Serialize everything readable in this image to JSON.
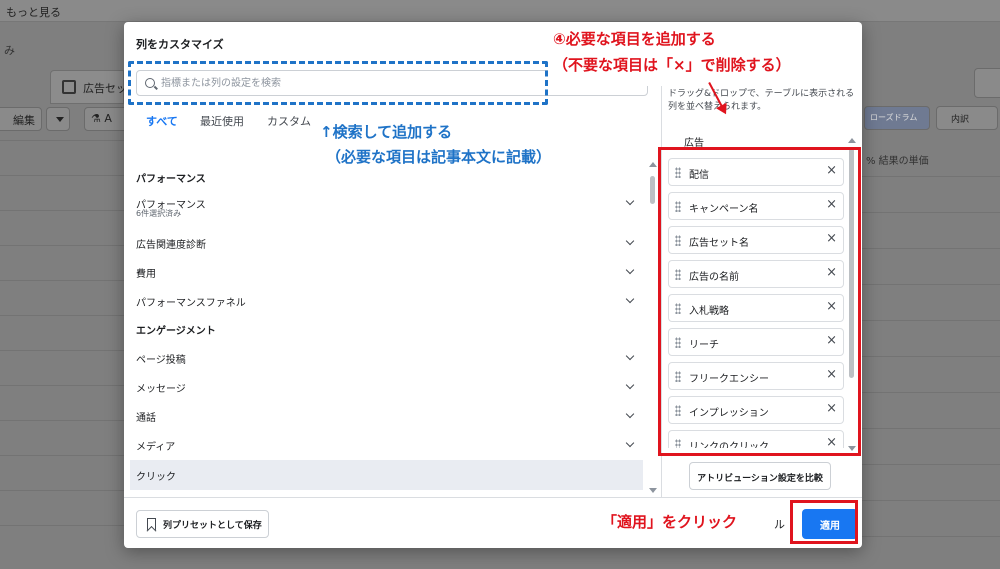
{
  "background": {
    "top_text": "もっと見る",
    "row2_text": "み",
    "tab_label": "広告セッ",
    "toolbar_edit": "編集",
    "toolbar_a": "A",
    "right_header_1": "% 結果の単価",
    "right_btn_1": "ローズドラム",
    "right_btn_2": "内訳"
  },
  "modal": {
    "title": "列をカスタマイズ",
    "search_placeholder": "指標または列の設定を検索",
    "tabs": [
      {
        "label": "すべて"
      },
      {
        "label": "最近使用"
      },
      {
        "label": "カスタム"
      }
    ],
    "categories": [
      {
        "type": "head",
        "label": "パフォーマンス"
      },
      {
        "type": "item",
        "label": "パフォーマンス",
        "sub": "6件選択済み"
      },
      {
        "type": "item",
        "label": "広告関連度診断"
      },
      {
        "type": "item",
        "label": "費用"
      },
      {
        "type": "item",
        "label": "パフォーマンスファネル"
      },
      {
        "type": "head",
        "label": "エンゲージメント"
      },
      {
        "type": "item",
        "label": "ページ投稿"
      },
      {
        "type": "item",
        "label": "メッセージ"
      },
      {
        "type": "item",
        "label": "通話"
      },
      {
        "type": "item",
        "label": "メディア"
      },
      {
        "type": "item",
        "label": "クリック"
      }
    ],
    "right_description": "ドラッグ&ドロップで、テーブルに表示される列を並べ替えられます。",
    "right_header": "広告",
    "chosen_columns": [
      {
        "label": "配信"
      },
      {
        "label": "キャンペーン名"
      },
      {
        "label": "広告セット名"
      },
      {
        "label": "広告の名前"
      },
      {
        "label": "入札戦略"
      },
      {
        "label": "リーチ"
      },
      {
        "label": "フリークエンシー"
      },
      {
        "label": "インプレッション"
      },
      {
        "label": "リンクのクリック"
      }
    ],
    "remove_glyph": "×",
    "compare_button": "アトリビューション設定を比較",
    "save_preset_button": "列プリセットとして保存",
    "cancel_partial": "ル",
    "apply_button": "適用"
  },
  "annotations": {
    "search_line1": "↑検索して追加する",
    "search_line2": "（必要な項目は記事本文に記載）",
    "add_line1": "④必要な項目を追加する",
    "add_line2": "（不要な項目は「×」で削除する）",
    "apply_note": "「適用」をクリック"
  },
  "colors": {
    "accent": "#1877f2",
    "annotation_blue": "#1f73c7",
    "annotation_red": "#e0141e"
  }
}
